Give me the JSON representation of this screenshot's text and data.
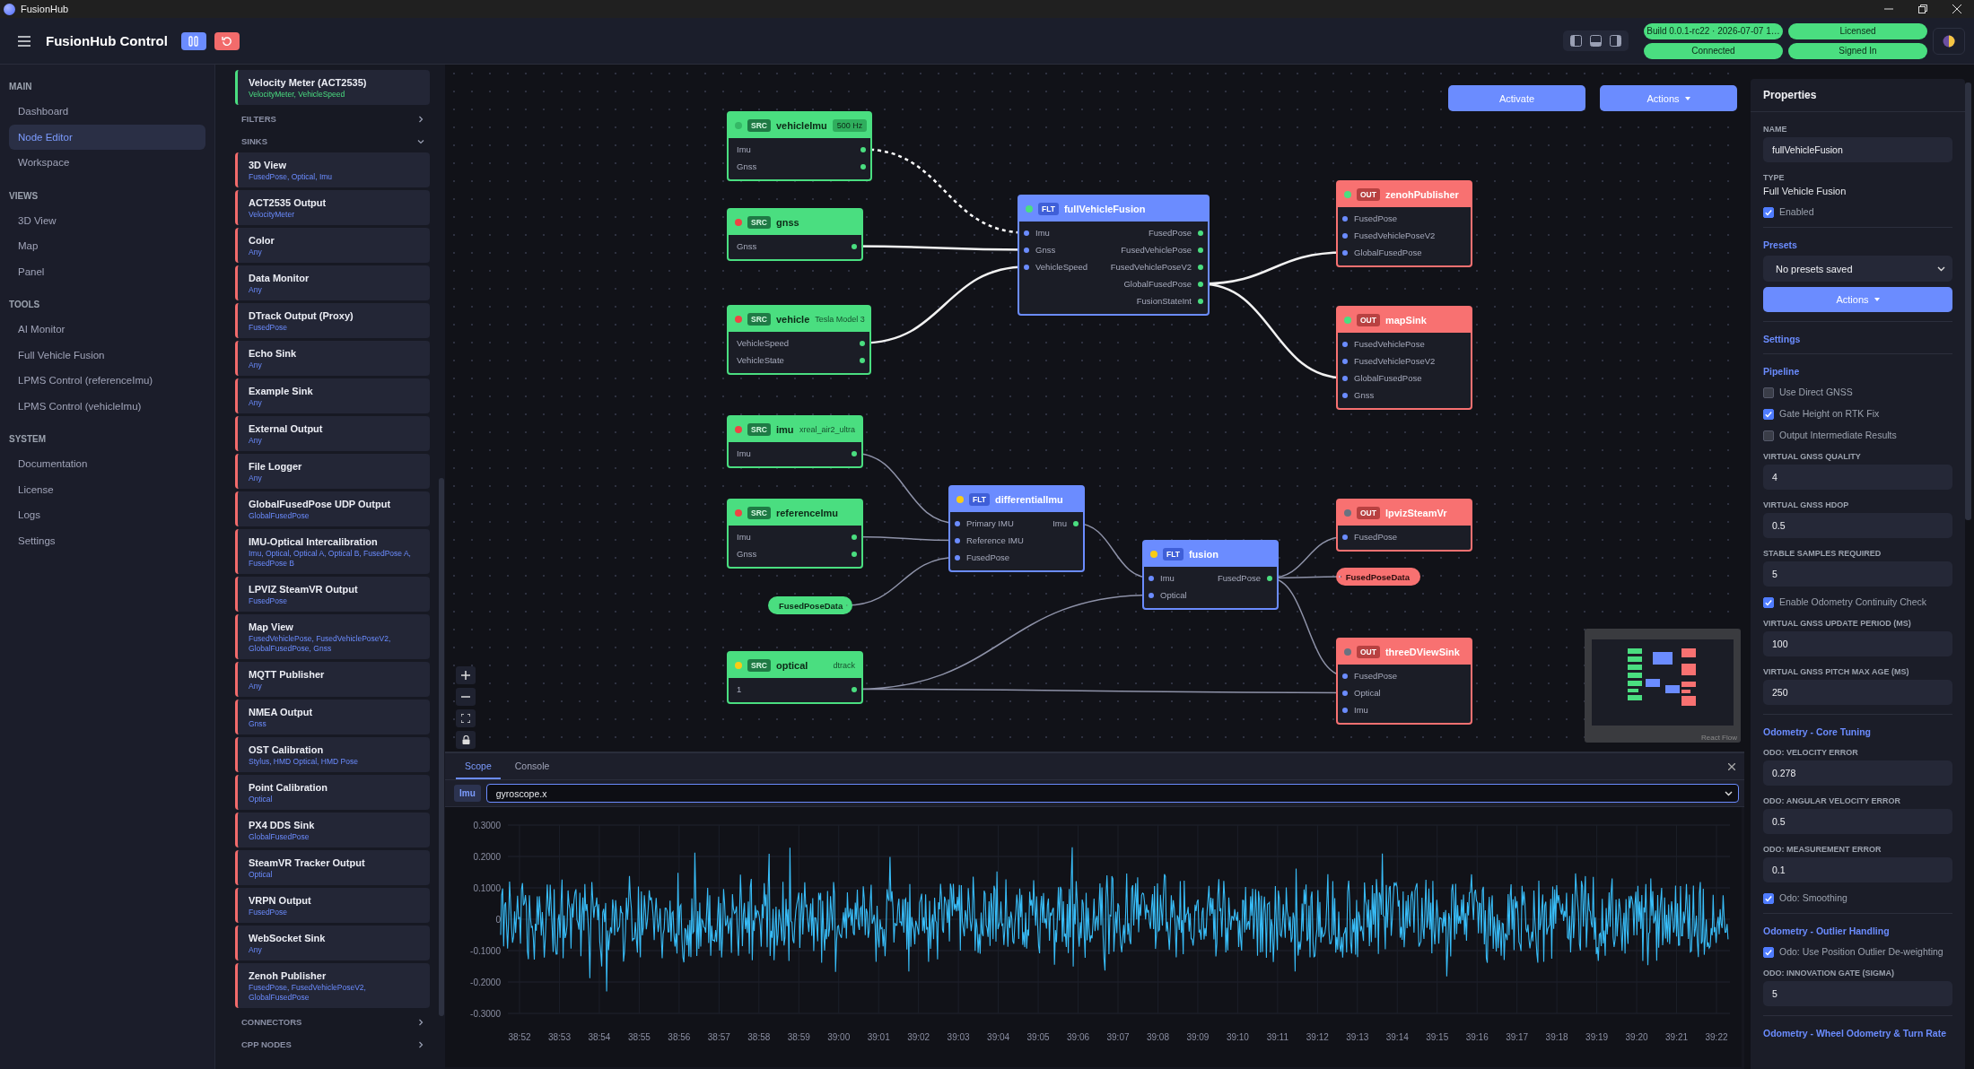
{
  "window": {
    "title": "FusionHub"
  },
  "header": {
    "title": "FusionHub Control",
    "status_pills": [
      {
        "label": "Build 0.0.1-rc22 · 2026-07-07 1…"
      },
      {
        "label": "Licensed"
      },
      {
        "label": "Connected"
      },
      {
        "label": "Signed In"
      }
    ]
  },
  "nav": {
    "sections": [
      {
        "title": "MAIN",
        "items": [
          {
            "label": "Dashboard",
            "selected": false
          },
          {
            "label": "Node Editor",
            "selected": true
          },
          {
            "label": "Workspace",
            "selected": false
          }
        ]
      },
      {
        "title": "VIEWS",
        "items": [
          {
            "label": "3D View",
            "selected": false
          },
          {
            "label": "Map",
            "selected": false
          },
          {
            "label": "Panel",
            "selected": false
          }
        ]
      },
      {
        "title": "TOOLS",
        "items": [
          {
            "label": "AI Monitor",
            "selected": false
          },
          {
            "label": "Full Vehicle Fusion",
            "selected": false
          },
          {
            "label": "LPMS Control (referenceImu)",
            "selected": false
          },
          {
            "label": "LPMS Control (vehicleImu)",
            "selected": false
          }
        ]
      },
      {
        "title": "SYSTEM",
        "items": [
          {
            "label": "Documentation",
            "selected": false
          },
          {
            "label": "License",
            "selected": false
          },
          {
            "label": "Logs",
            "selected": false
          },
          {
            "label": "Settings",
            "selected": false
          }
        ]
      }
    ]
  },
  "palette": [
    {
      "kind": "source",
      "name": "Velocity Meter (ACT2535)",
      "ports": "VelocityMeter, VehicleSpeed"
    },
    {
      "kind": "group",
      "title": "FILTERS",
      "expanded": false
    },
    {
      "kind": "group",
      "title": "SINKS",
      "expanded": true
    },
    {
      "kind": "sink",
      "name": "3D View",
      "ports": "FusedPose, Optical, Imu"
    },
    {
      "kind": "sink",
      "name": "ACT2535 Output",
      "ports": "VelocityMeter"
    },
    {
      "kind": "sink",
      "name": "Color",
      "ports": "Any"
    },
    {
      "kind": "sink",
      "name": "Data Monitor",
      "ports": "Any"
    },
    {
      "kind": "sink",
      "name": "DTrack Output (Proxy)",
      "ports": "FusedPose"
    },
    {
      "kind": "sink",
      "name": "Echo Sink",
      "ports": "Any"
    },
    {
      "kind": "sink",
      "name": "Example Sink",
      "ports": "Any"
    },
    {
      "kind": "sink",
      "name": "External Output",
      "ports": "Any"
    },
    {
      "kind": "sink",
      "name": "File Logger",
      "ports": "Any"
    },
    {
      "kind": "sink",
      "name": "GlobalFusedPose UDP Output",
      "ports": "GlobalFusedPose"
    },
    {
      "kind": "sink",
      "name": "IMU-Optical Intercalibration",
      "ports": "Imu, Optical, Optical A, Optical B, FusedPose A, FusedPose B"
    },
    {
      "kind": "sink",
      "name": "LPVIZ SteamVR Output",
      "ports": "FusedPose"
    },
    {
      "kind": "sink",
      "name": "Map View",
      "ports": "FusedVehiclePose, FusedVehiclePoseV2, GlobalFusedPose, Gnss"
    },
    {
      "kind": "sink",
      "name": "MQTT Publisher",
      "ports": "Any"
    },
    {
      "kind": "sink",
      "name": "NMEA Output",
      "ports": "Gnss"
    },
    {
      "kind": "sink",
      "name": "OST Calibration",
      "ports": "Stylus, HMD Optical, HMD Pose"
    },
    {
      "kind": "sink",
      "name": "Point Calibration",
      "ports": "Optical"
    },
    {
      "kind": "sink",
      "name": "PX4 DDS Sink",
      "ports": "GlobalFusedPose"
    },
    {
      "kind": "sink",
      "name": "SteamVR Tracker Output",
      "ports": "Optical"
    },
    {
      "kind": "sink",
      "name": "VRPN Output",
      "ports": "FusedPose"
    },
    {
      "kind": "sink",
      "name": "WebSocket Sink",
      "ports": "Any"
    },
    {
      "kind": "sink",
      "name": "Zenoh Publisher",
      "ports": "FusedPose, FusedVehiclePoseV2, GlobalFusedPose"
    },
    {
      "kind": "group",
      "title": "CONNECTORS",
      "expanded": false
    },
    {
      "kind": "group",
      "title": "CPP NODES",
      "expanded": false
    }
  ],
  "canvas": {
    "buttons": [
      {
        "label": "Activate",
        "kind": "plain"
      },
      {
        "label": "Actions",
        "kind": "menu"
      }
    ],
    "nodes": [
      {
        "kind": "source",
        "tag": "SRC",
        "name": "vehicleImu",
        "detail": "500 Hz",
        "detail_boxed": true,
        "color": "#35b866",
        "outputs": [
          "Imu",
          "Gnss"
        ]
      },
      {
        "kind": "source",
        "tag": "SRC",
        "name": "gnss",
        "color": "#ef4444",
        "outputs": [
          "Gnss"
        ]
      },
      {
        "kind": "source",
        "tag": "SRC",
        "name": "vehicle",
        "detail": "Tesla Model 3",
        "detail_boxed": false,
        "color": "#ef4444",
        "outputs": [
          "VehicleSpeed",
          "VehicleState"
        ]
      },
      {
        "kind": "source",
        "tag": "SRC",
        "name": "imu",
        "detail": "xreal_air2_ultra",
        "detail_boxed": false,
        "color": "#ef4444",
        "outputs": [
          "Imu"
        ]
      },
      {
        "kind": "source",
        "tag": "SRC",
        "name": "referenceImu",
        "color": "#ef4444",
        "outputs": [
          "Imu",
          "Gnss"
        ]
      },
      {
        "kind": "input_pill",
        "name": "FusedPoseData"
      },
      {
        "kind": "source",
        "tag": "SRC",
        "name": "optical",
        "detail": "dtrack",
        "detail_boxed": false,
        "color": "#facc15",
        "outputs": [
          "1"
        ]
      },
      {
        "kind": "filter",
        "tag": "FLT",
        "name": "fullVehicleFusion",
        "color": "#4ade80",
        "inputs": [
          "Imu",
          "Gnss",
          "VehicleSpeed"
        ],
        "outputs": [
          "FusedPose",
          "FusedVehiclePose",
          "FusedVehiclePoseV2",
          "GlobalFusedPose",
          "FusionStateInt"
        ]
      },
      {
        "kind": "filter",
        "tag": "FLT",
        "name": "differentialImu",
        "color": "#facc15",
        "inputs": [
          "Primary IMU",
          "Reference IMU",
          "FusedPose"
        ],
        "outputs": [
          "Imu"
        ]
      },
      {
        "kind": "filter",
        "tag": "FLT",
        "name": "fusion",
        "color": "#facc15",
        "inputs": [
          "Imu",
          "Optical"
        ],
        "outputs": [
          "FusedPose"
        ]
      },
      {
        "kind": "output",
        "tag": "OUT",
        "name": "zenohPublisher",
        "color": "#4ade80",
        "inputs": [
          "FusedPose",
          "FusedVehiclePoseV2",
          "GlobalFusedPose"
        ]
      },
      {
        "kind": "output",
        "tag": "OUT",
        "name": "mapSink",
        "color": "#4ade80",
        "inputs": [
          "FusedVehiclePose",
          "FusedVehiclePoseV2",
          "GlobalFusedPose",
          "Gnss"
        ]
      },
      {
        "kind": "output",
        "tag": "OUT",
        "name": "lpvizSteamVr",
        "color": "#6b7280",
        "inputs": [
          "FusedPose"
        ]
      },
      {
        "kind": "output_pill",
        "name": "FusedPoseData"
      },
      {
        "kind": "output",
        "tag": "OUT",
        "name": "threeDViewSink",
        "color": "#6b7280",
        "inputs": [
          "FusedPose",
          "Optical",
          "Imu"
        ]
      }
    ],
    "attribution": "React Flow"
  },
  "scope": {
    "tabs": [
      {
        "label": "Scope",
        "selected": true
      },
      {
        "label": "Console",
        "selected": false
      }
    ],
    "source": "Imu",
    "channel": "gyroscope.x",
    "y_ticks": [
      "0.3000",
      "0.2000",
      "0.1000",
      "0",
      "-0.1000",
      "-0.2000",
      "-0.3000"
    ],
    "x_ticks": [
      "38:52",
      "38:53",
      "38:54",
      "38:55",
      "38:56",
      "38:57",
      "38:58",
      "38:59",
      "39:00",
      "39:01",
      "39:02",
      "39:03",
      "39:04",
      "39:05",
      "39:06",
      "39:07",
      "39:08",
      "39:09",
      "39:10",
      "39:11",
      "39:12",
      "39:13",
      "39:14",
      "39:15",
      "39:16",
      "39:17",
      "39:18",
      "39:19",
      "39:20",
      "39:21",
      "39:22"
    ]
  },
  "properties": {
    "title": "Properties",
    "items": [
      {
        "kind": "field",
        "label": "NAME",
        "value": "fullVehicleFusion"
      },
      {
        "kind": "info",
        "label": "TYPE",
        "value": "Full Vehicle Fusion"
      },
      {
        "kind": "checkbox",
        "label": "Enabled",
        "checked": true
      },
      {
        "kind": "divider"
      },
      {
        "kind": "section",
        "label": "Presets"
      },
      {
        "kind": "select",
        "value": "No presets saved"
      },
      {
        "kind": "button",
        "label": "Actions"
      },
      {
        "kind": "divider"
      },
      {
        "kind": "section",
        "label": "Settings"
      },
      {
        "kind": "divider"
      },
      {
        "kind": "section",
        "label": "Pipeline"
      },
      {
        "kind": "checkbox",
        "label": "Use Direct GNSS",
        "checked": false
      },
      {
        "kind": "checkbox",
        "label": "Gate Height on RTK Fix",
        "checked": true
      },
      {
        "kind": "checkbox",
        "label": "Output Intermediate Results",
        "checked": false
      },
      {
        "kind": "field",
        "label": "VIRTUAL GNSS QUALITY",
        "value": "4"
      },
      {
        "kind": "field",
        "label": "VIRTUAL GNSS HDOP",
        "value": "0.5"
      },
      {
        "kind": "field",
        "label": "STABLE SAMPLES REQUIRED",
        "value": "5"
      },
      {
        "kind": "checkbox",
        "label": "Enable Odometry Continuity Check",
        "checked": true
      },
      {
        "kind": "field",
        "label": "VIRTUAL GNSS UPDATE PERIOD (MS)",
        "value": "100"
      },
      {
        "kind": "field",
        "label": "VIRTUAL GNSS PITCH MAX AGE (MS)",
        "value": "250"
      },
      {
        "kind": "divider"
      },
      {
        "kind": "section",
        "label": "Odometry - Core Tuning"
      },
      {
        "kind": "field",
        "label": "ODO: VELOCITY ERROR",
        "value": "0.278"
      },
      {
        "kind": "field",
        "label": "ODO: ANGULAR VELOCITY ERROR",
        "value": "0.5"
      },
      {
        "kind": "field",
        "label": "ODO: MEASUREMENT ERROR",
        "value": "0.1"
      },
      {
        "kind": "checkbox",
        "label": "Odo: Smoothing",
        "checked": true
      },
      {
        "kind": "divider"
      },
      {
        "kind": "section",
        "label": "Odometry - Outlier Handling"
      },
      {
        "kind": "checkbox",
        "label": "Odo: Use Position Outlier De-weighting",
        "checked": true
      },
      {
        "kind": "field",
        "label": "ODO: INNOVATION GATE (SIGMA)",
        "value": "5"
      },
      {
        "kind": "divider"
      },
      {
        "kind": "section",
        "label": "Odometry - Wheel Odometry & Turn Rate"
      }
    ]
  }
}
